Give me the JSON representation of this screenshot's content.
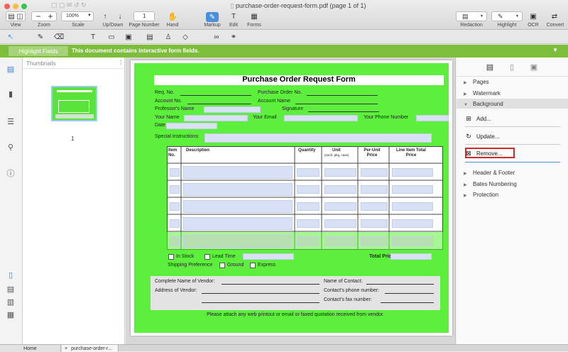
{
  "window": {
    "title": "purchase-order-request-form.pdf (page 1 of 1)"
  },
  "toolbar": {
    "view_label": "View",
    "zoom_label": "Zoom",
    "zoom_minus": "−",
    "zoom_plus": "+",
    "scale_label": "Scale",
    "scale_value": "100%",
    "updown_label": "Up/Down",
    "page_number_label": "Page Number",
    "page_number_value": "1",
    "hand_label": "Hand",
    "markup_label": "Markup",
    "edit_label": "Edit",
    "forms_label": "Forms",
    "redaction_label": "Redaction",
    "highlight_label": "Highlight",
    "ocr_label": "OCR",
    "convert_label": "Convert"
  },
  "notify": {
    "button_label": "Highlight Fields",
    "message": "This document contains interactive form fields."
  },
  "thumbnails": {
    "header": "Thumbnails",
    "page_label": "1"
  },
  "form": {
    "title": "Purchase Order Request Form",
    "req_no": "Req. No.",
    "po_no": "Purchase Order No.",
    "account_no": "Account No.",
    "account_name": "Account Name",
    "professor_name": "Professor's Name",
    "signature": "Signature",
    "your_name": "Your Name",
    "your_email": "Your Email",
    "your_phone": "Your Phone Number",
    "date": "Date",
    "special_instructions": "Special Instructions:",
    "table_headers": [
      "Item No.",
      "Description",
      "Quantity",
      "Unit",
      "(each, pkg, case)",
      "Per-Unit Price",
      "Line Item Total Price"
    ],
    "in_stock": "In Stock",
    "lead_time": "Lead Time",
    "total_price": "Total Price",
    "shipping_pref": "Shipping Preference",
    "ground": "Ground",
    "express": "Express",
    "vendor_name": "Complete Name of Vendor:",
    "vendor_address": "Address of Vendor:",
    "contact_name": "Name of Contact:",
    "contact_phone": "Contact's phone number:",
    "contact_fax": "Contact's fax number:",
    "footer_note": "Please attach any web printout or email or faxed quotation received from vendor."
  },
  "rpanel": {
    "pages": "Pages",
    "watermark": "Watermark",
    "background": "Background",
    "add": "Add...",
    "update": "Update...",
    "remove": "Remove...",
    "header_footer": "Header & Footer",
    "bates": "Bates Numbering",
    "protection": "Protection"
  },
  "tabs": {
    "home": "Home",
    "doc": "purchase-order-r...",
    "close": "×"
  },
  "colors": {
    "accent": "#4a90d9",
    "notify_green": "#7cbd3c",
    "form_green": "#5cf03d",
    "remove_border": "#d22a2a"
  }
}
